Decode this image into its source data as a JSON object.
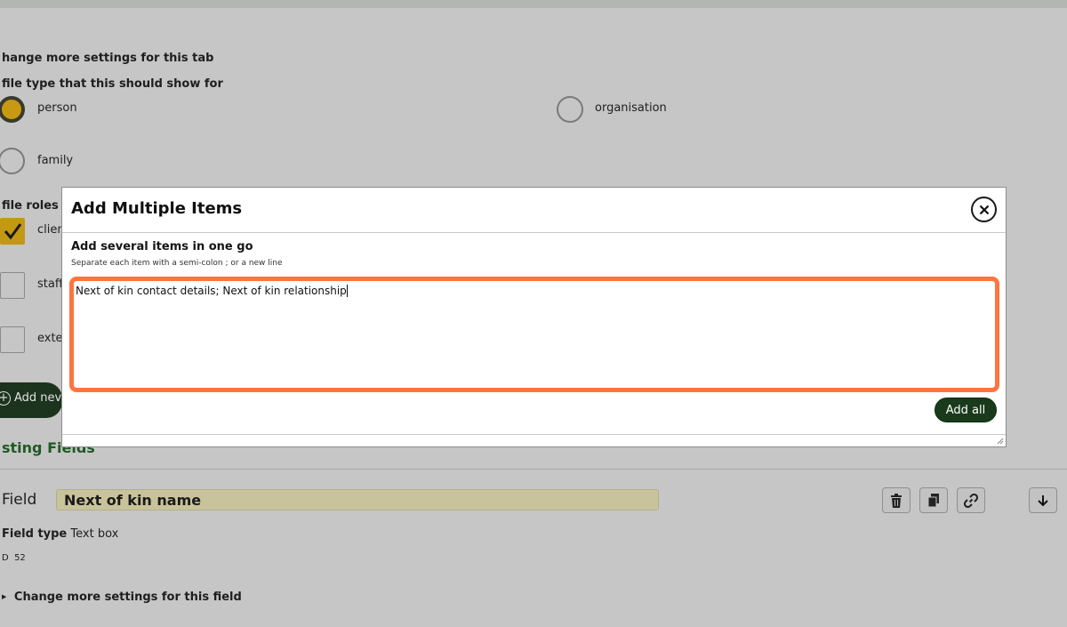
{
  "background": {
    "settings_tab_label": "hange more settings for this tab",
    "profile_type_label": "file type that this should show for",
    "radio_options": [
      {
        "label": "person",
        "checked": true
      },
      {
        "label": "organisation",
        "checked": false
      },
      {
        "label": "family",
        "checked": false
      }
    ],
    "roles_label": "file roles th",
    "role_options": [
      {
        "label": "clien",
        "checked": true
      },
      {
        "label": "staff",
        "checked": false
      },
      {
        "label": "exte",
        "checked": false
      }
    ],
    "add_new_label": "Add nev",
    "existing_fields_label": "sting Fields",
    "field_label": "Field",
    "field_name_value": "Next of kin name",
    "field_type_label": "Field type",
    "field_type_value": "Text box",
    "id_label": "D",
    "id_value": "52",
    "change_field_settings": "Change more settings for this field"
  },
  "modal": {
    "title": "Add Multiple Items",
    "label": "Add several items in one go",
    "hint": "Separate each item with a semi-colon ; or a new line",
    "textarea_value": "Next of kin contact details; Next of kin relationship",
    "add_all_label": "Add all"
  },
  "icons": [
    "close-icon",
    "trash-icon",
    "copy-icon",
    "link-icon",
    "arrow-down-icon",
    "checkmark-icon",
    "plus-icon",
    "triangle-right-icon"
  ],
  "colors": {
    "accent_orange": "#ff7440",
    "brand_green": "#1a3a1c",
    "gold": "#c79a11"
  }
}
